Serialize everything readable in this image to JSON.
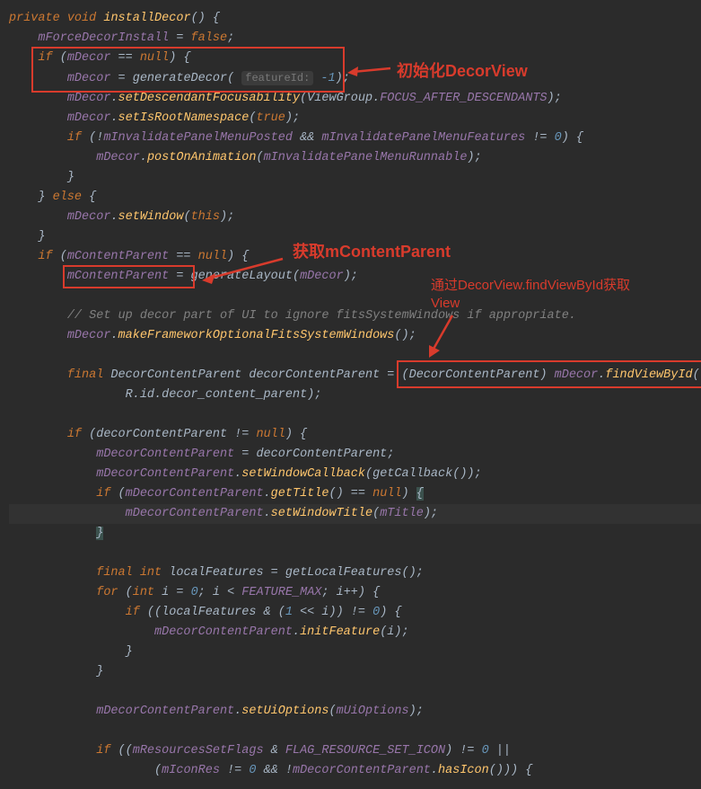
{
  "annotations": {
    "anno1": "初始化DecorView",
    "anno2": "获取mContentParent",
    "anno3_line1": "通过DecorView.findViewById获取",
    "anno3_line2": "View"
  },
  "code": {
    "l1_kw1": "private",
    "l1_kw2": "void",
    "l1_mtd": "installDecor",
    "l1_tail": "() {",
    "l2_var": "mForceDecorInstall",
    "l2_eq": " = ",
    "l2_kw": "false",
    "l2_semi": ";",
    "l3_kw": "if",
    "l3_open": " (",
    "l3_var": "mDecor",
    "l3_eq": " == ",
    "l3_null": "null",
    "l3_close": ") {",
    "l4_var": "mDecor",
    "l4_eq": " = ",
    "l4_mtd": "generateDecor",
    "l4_open": "( ",
    "l4_hint": "featureId:",
    "l4_num": " -1",
    "l4_close": ");",
    "l5_var": "mDecor",
    "l5_dot": ".",
    "l5_mtd": "setDescendantFocusability",
    "l5_open": "(ViewGroup.",
    "l5_const": "FOCUS_AFTER_DESCENDANTS",
    "l5_close": ");",
    "l6_var": "mDecor",
    "l6_dot": ".",
    "l6_mtd": "setIsRootNamespace",
    "l6_open": "(",
    "l6_kw": "true",
    "l6_close": ");",
    "l7_kw": "if",
    "l7_open": " (!",
    "l7_var1": "mInvalidatePanelMenuPosted",
    "l7_amp": " && ",
    "l7_var2": "mInvalidatePanelMenuFeatures",
    "l7_ne": " != ",
    "l7_num": "0",
    "l7_close": ") {",
    "l8_var": "mDecor",
    "l8_dot": ".",
    "l8_mtd": "postOnAnimation",
    "l8_open": "(",
    "l8_arg": "mInvalidatePanelMenuRunnable",
    "l8_close": ");",
    "l9": "}",
    "l10": "} ",
    "l10_kw": "else",
    "l10_close": " {",
    "l11_var": "mDecor",
    "l11_dot": ".",
    "l11_mtd": "setWindow",
    "l11_open": "(",
    "l11_kw": "this",
    "l11_close": ");",
    "l12": "}",
    "l13_kw": "if",
    "l13_open": " (",
    "l13_var": "mContentParent",
    "l13_eq": " == ",
    "l13_null": "null",
    "l13_close": ") {",
    "l14_var": "mContentParent",
    "l14_eq": " = ",
    "l14_mtd": "generateLayout",
    "l14_open": "(",
    "l14_arg": "mDecor",
    "l14_close": ");",
    "l16_cmt": "// Set up decor part of UI to ignore fitsSystemWindows if appropriate.",
    "l17_var": "mDecor",
    "l17_dot": ".",
    "l17_mtd": "makeFrameworkOptionalFitsSystemWindows",
    "l17_tail": "();",
    "l19_kw": "final",
    "l19_type": " DecorContentParent ",
    "l19_var": "decorContentParent",
    "l19_eq": " = (",
    "l19_cast": "DecorContentParent",
    "l19_close": ") ",
    "l19_obj": "mDecor",
    "l19_dot": ".",
    "l19_mtd": "findViewById",
    "l19_paren": "(",
    "l20_r": "R",
    "l20_tail": ".id.decor_content_parent);",
    "l22_kw": "if",
    "l22_open": " (decorContentParent != ",
    "l22_null": "null",
    "l22_close": ") {",
    "l23_var": "mDecorContentParent",
    "l23_eq": " = decorContentParent;",
    "l24_var": "mDecorContentParent",
    "l24_dot": ".",
    "l24_mtd": "setWindowCallback",
    "l24_tail": "(getCallback());",
    "l25_kw": "if",
    "l25_open": " (",
    "l25_var": "mDecorContentParent",
    "l25_dot": ".",
    "l25_mtd": "getTitle",
    "l25_tail": "() == ",
    "l25_null": "null",
    "l25_close": ") ",
    "l25_brace": "{",
    "l26_var": "mDecorContentParent",
    "l26_dot": ".",
    "l26_mtd": "setWindowTitle",
    "l26_open": "(",
    "l26_arg": "mTitle",
    "l26_close": ");",
    "l27": "}",
    "l29_kw1": "final",
    "l29_kw2": " int",
    "l29_var": " localFeatures = getLocalFeatures();",
    "l30_kw": "for",
    "l30_open": " (",
    "l30_int": "int",
    "l30_var": " i = ",
    "l30_n1": "0",
    "l30_semi": "; i < ",
    "l30_const": "FEATURE_MAX",
    "l30_inc": "; i++) {",
    "l31_kw": "if",
    "l31_open": " ((localFeatures & (",
    "l31_n1": "1",
    "l31_shift": " << i)) != ",
    "l31_n2": "0",
    "l31_close": ") {",
    "l32_var": "mDecorContentParent",
    "l32_dot": ".",
    "l32_mtd": "initFeature",
    "l32_tail": "(i);",
    "l33": "}",
    "l34": "}",
    "l36_var": "mDecorContentParent",
    "l36_dot": ".",
    "l36_mtd": "setUiOptions",
    "l36_open": "(",
    "l36_arg": "mUiOptions",
    "l36_close": ");",
    "l38_kw": "if",
    "l38_open": " ((",
    "l38_var": "mResourcesSetFlags",
    "l38_amp": " & ",
    "l38_const": "FLAG_RESOURCE_SET_ICON",
    "l38_tail": ") != ",
    "l38_n": "0",
    "l38_or": " ||",
    "l39_open": "(",
    "l39_var": "mIconRes",
    "l39_ne": " != ",
    "l39_n": "0",
    "l39_amp": " && !",
    "l39_obj": "mDecorContentParent",
    "l39_dot": ".",
    "l39_mtd": "hasIcon",
    "l39_tail": "())) {"
  }
}
